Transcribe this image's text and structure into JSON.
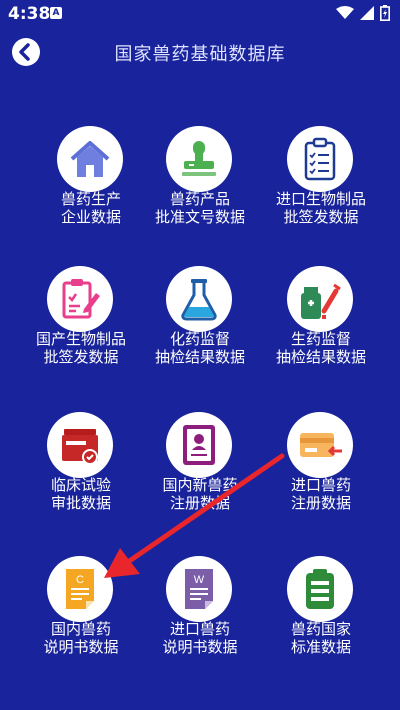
{
  "status": {
    "time": "4:38",
    "notif": "A"
  },
  "header": {
    "title": "国家兽药基础数据库"
  },
  "tiles": [
    {
      "l1": "兽药生产",
      "l2": "企业数据",
      "icon": "house-icon"
    },
    {
      "l1": "兽药产品",
      "l2": "批准文号数据",
      "icon": "stamp-icon"
    },
    {
      "l1": "进口生物制品",
      "l2": "批签发数据",
      "icon": "clipboard-checklist-icon"
    },
    {
      "l1": "国产生物制品",
      "l2": "批签发数据",
      "icon": "clipboard-pen-icon"
    },
    {
      "l1": "化药监督",
      "l2": "抽检结果数据",
      "icon": "flask-icon"
    },
    {
      "l1": "生药监督",
      "l2": "抽检结果数据",
      "icon": "medicine-syringe-icon"
    },
    {
      "l1": "临床试验",
      "l2": "审批数据",
      "icon": "approval-folder-icon"
    },
    {
      "l1": "国内新兽药",
      "l2": "注册数据",
      "icon": "id-document-icon"
    },
    {
      "l1": "进口兽药",
      "l2": "注册数据",
      "icon": "import-card-icon"
    },
    {
      "l1": "国内兽药",
      "l2": "说明书数据",
      "icon": "document-c-icon"
    },
    {
      "l1": "进口兽药",
      "l2": "说明书数据",
      "icon": "document-w-icon"
    },
    {
      "l1": "兽药国家",
      "l2": "标准数据",
      "icon": "standard-clipboard-icon"
    }
  ],
  "colors": {
    "background": "#19239b",
    "arrow": "#e8262b"
  }
}
